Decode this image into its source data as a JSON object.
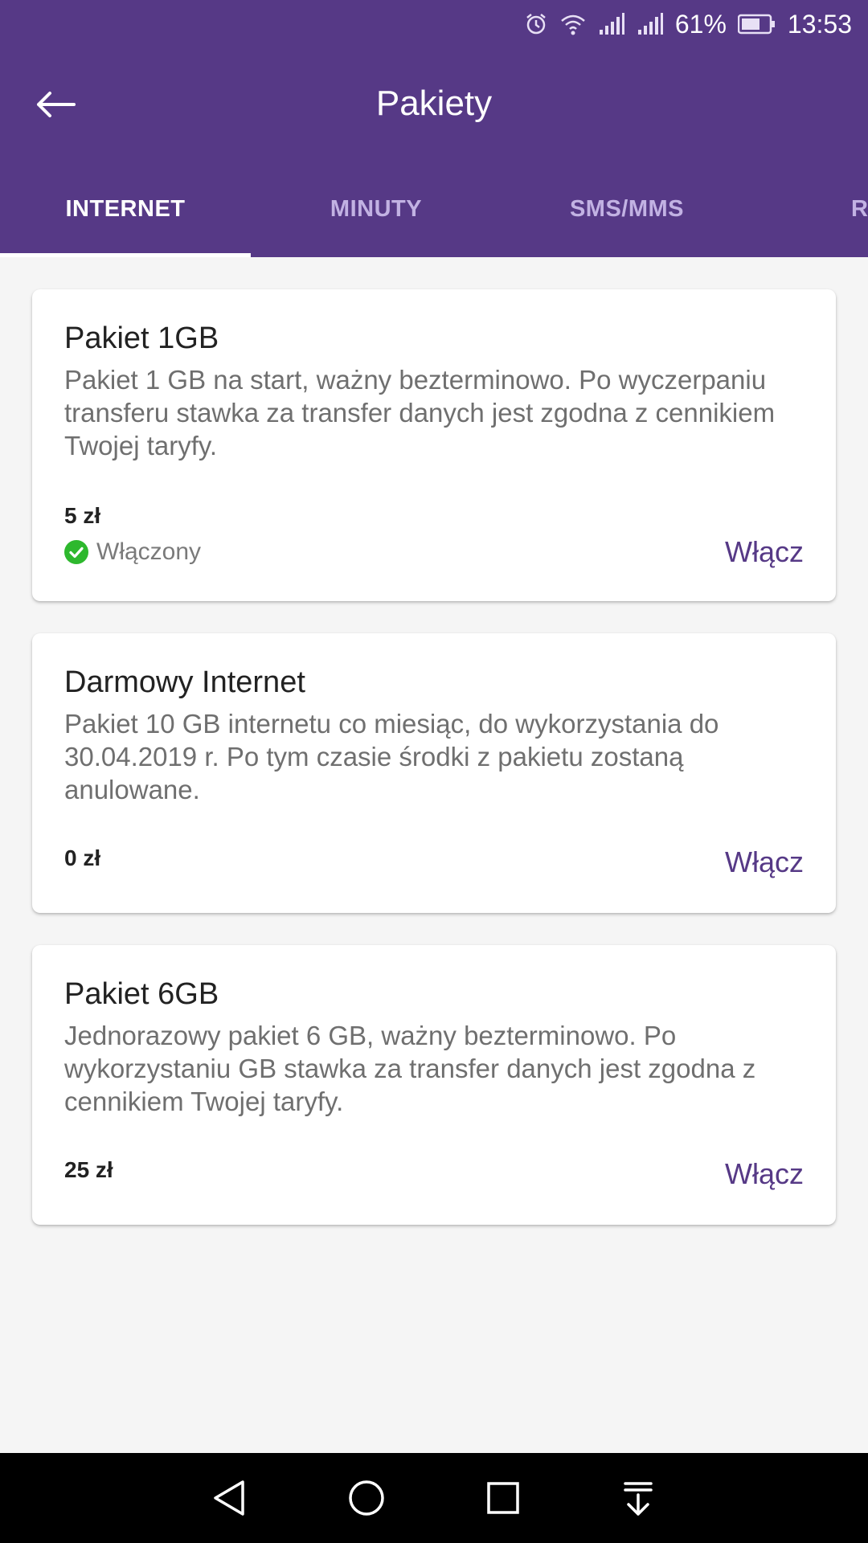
{
  "status_bar": {
    "battery_percent": "61%",
    "time": "13:53",
    "icons": [
      "alarm-icon",
      "wifi-icon",
      "signal-icon",
      "signal-icon",
      "battery-icon"
    ]
  },
  "app_bar": {
    "title": "Pakiety",
    "back_icon": "arrow-left-icon",
    "color": "#563986"
  },
  "tabs": [
    {
      "label": "INTERNET",
      "active": true
    },
    {
      "label": "MINUTY",
      "active": false
    },
    {
      "label": "SMS/MMS",
      "active": false
    },
    {
      "label": "ROA",
      "active": false
    }
  ],
  "packages": [
    {
      "title": "Pakiet 1GB",
      "description": "Pakiet 1 GB na start, ważny bezterminowo. Po wyczerpaniu transferu stawka za transfer danych jest zgodna z cennikiem Twojej taryfy.",
      "price": "5 zł",
      "status": "Włączony",
      "action": "Włącz"
    },
    {
      "title": "Darmowy Internet",
      "description": "Pakiet 10 GB internetu co miesiąc, do wykorzystania do 30.04.2019 r. Po tym czasie środki z pakietu zostaną anulowane.",
      "price": "0 zł",
      "action": "Włącz"
    },
    {
      "title": "Pakiet 6GB",
      "description": "Jednorazowy pakiet 6 GB, ważny bezterminowo. Po wykorzystaniu GB stawka za transfer danych jest zgodna z cennikiem Twojej taryfy.",
      "price": "25 zł",
      "action": "Włącz"
    }
  ],
  "nav_bar": {
    "icons": [
      "back-triangle-icon",
      "home-circle-icon",
      "recents-square-icon",
      "notifications-down-icon"
    ]
  },
  "colors": {
    "accent": "#563986",
    "status_ok": "#2eb82e"
  }
}
